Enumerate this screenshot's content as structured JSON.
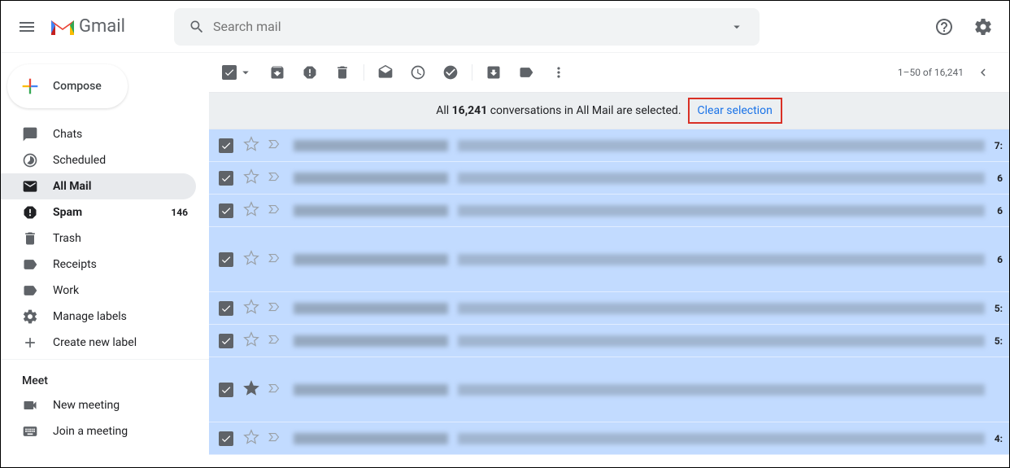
{
  "header": {
    "app_name": "Gmail",
    "search_placeholder": "Search mail"
  },
  "sidebar": {
    "compose": "Compose",
    "items": [
      {
        "icon": "chat",
        "label": "Chats"
      },
      {
        "icon": "scheduled",
        "label": "Scheduled"
      },
      {
        "icon": "allmail",
        "label": "All Mail",
        "active": true
      },
      {
        "icon": "spam",
        "label": "Spam",
        "count": "146",
        "bold": true
      },
      {
        "icon": "trash",
        "label": "Trash"
      },
      {
        "icon": "label",
        "label": "Receipts"
      },
      {
        "icon": "label",
        "label": "Work"
      },
      {
        "icon": "gear",
        "label": "Manage labels"
      },
      {
        "icon": "plus",
        "label": "Create new label"
      }
    ],
    "meet_header": "Meet",
    "meet_items": [
      {
        "icon": "camera",
        "label": "New meeting"
      },
      {
        "icon": "keyboard",
        "label": "Join a meeting"
      }
    ]
  },
  "toolbar": {
    "page_range": "1–50 of 16,241"
  },
  "banner": {
    "prefix": "All ",
    "count": "16,241",
    "suffix": " conversations in All Mail are selected.",
    "clear": "Clear selection"
  },
  "rows": [
    {
      "time": "7:",
      "tall": false
    },
    {
      "time": "6",
      "tall": false
    },
    {
      "time": "6",
      "tall": false
    },
    {
      "time": "6",
      "tall": true
    },
    {
      "time": "5:",
      "tall": false
    },
    {
      "time": "5:",
      "tall": false
    },
    {
      "time": "",
      "tall": true,
      "starred": true
    },
    {
      "time": "4:",
      "tall": false
    }
  ]
}
